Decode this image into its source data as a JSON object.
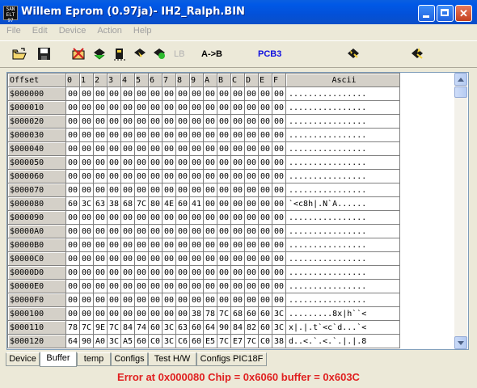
{
  "window": {
    "title": "Willem Eprom (0.97ja)- IH2_Ralph.BIN",
    "icon_text": "SAN\nELT\n97"
  },
  "menu": [
    "File",
    "Edit",
    "Device",
    "Action",
    "Help"
  ],
  "toolbar": {
    "lb_label": "LB",
    "ab_label": "A->B",
    "pcb_label": "PCB3",
    "pcb_color": "#1010E0"
  },
  "grid": {
    "header": [
      "Offset",
      "0",
      "1",
      "2",
      "3",
      "4",
      "5",
      "6",
      "7",
      "8",
      "9",
      "A",
      "B",
      "C",
      "D",
      "E",
      "F",
      "Ascii"
    ],
    "rows": [
      {
        "offset": "$000000",
        "bytes": [
          "00",
          "00",
          "00",
          "00",
          "00",
          "00",
          "00",
          "00",
          "00",
          "00",
          "00",
          "00",
          "00",
          "00",
          "00",
          "00"
        ],
        "ascii": "................"
      },
      {
        "offset": "$000010",
        "bytes": [
          "00",
          "00",
          "00",
          "00",
          "00",
          "00",
          "00",
          "00",
          "00",
          "00",
          "00",
          "00",
          "00",
          "00",
          "00",
          "00"
        ],
        "ascii": "................"
      },
      {
        "offset": "$000020",
        "bytes": [
          "00",
          "00",
          "00",
          "00",
          "00",
          "00",
          "00",
          "00",
          "00",
          "00",
          "00",
          "00",
          "00",
          "00",
          "00",
          "00"
        ],
        "ascii": "................"
      },
      {
        "offset": "$000030",
        "bytes": [
          "00",
          "00",
          "00",
          "00",
          "00",
          "00",
          "00",
          "00",
          "00",
          "00",
          "00",
          "00",
          "00",
          "00",
          "00",
          "00"
        ],
        "ascii": "................"
      },
      {
        "offset": "$000040",
        "bytes": [
          "00",
          "00",
          "00",
          "00",
          "00",
          "00",
          "00",
          "00",
          "00",
          "00",
          "00",
          "00",
          "00",
          "00",
          "00",
          "00"
        ],
        "ascii": "................"
      },
      {
        "offset": "$000050",
        "bytes": [
          "00",
          "00",
          "00",
          "00",
          "00",
          "00",
          "00",
          "00",
          "00",
          "00",
          "00",
          "00",
          "00",
          "00",
          "00",
          "00"
        ],
        "ascii": "................"
      },
      {
        "offset": "$000060",
        "bytes": [
          "00",
          "00",
          "00",
          "00",
          "00",
          "00",
          "00",
          "00",
          "00",
          "00",
          "00",
          "00",
          "00",
          "00",
          "00",
          "00"
        ],
        "ascii": "................"
      },
      {
        "offset": "$000070",
        "bytes": [
          "00",
          "00",
          "00",
          "00",
          "00",
          "00",
          "00",
          "00",
          "00",
          "00",
          "00",
          "00",
          "00",
          "00",
          "00",
          "00"
        ],
        "ascii": "................"
      },
      {
        "offset": "$000080",
        "bytes": [
          "60",
          "3C",
          "63",
          "38",
          "68",
          "7C",
          "80",
          "4E",
          "60",
          "41",
          "00",
          "00",
          "00",
          "00",
          "00",
          "00"
        ],
        "ascii": "`<c8h|.N`A......"
      },
      {
        "offset": "$000090",
        "bytes": [
          "00",
          "00",
          "00",
          "00",
          "00",
          "00",
          "00",
          "00",
          "00",
          "00",
          "00",
          "00",
          "00",
          "00",
          "00",
          "00"
        ],
        "ascii": "................"
      },
      {
        "offset": "$0000A0",
        "bytes": [
          "00",
          "00",
          "00",
          "00",
          "00",
          "00",
          "00",
          "00",
          "00",
          "00",
          "00",
          "00",
          "00",
          "00",
          "00",
          "00"
        ],
        "ascii": "................"
      },
      {
        "offset": "$0000B0",
        "bytes": [
          "00",
          "00",
          "00",
          "00",
          "00",
          "00",
          "00",
          "00",
          "00",
          "00",
          "00",
          "00",
          "00",
          "00",
          "00",
          "00"
        ],
        "ascii": "................"
      },
      {
        "offset": "$0000C0",
        "bytes": [
          "00",
          "00",
          "00",
          "00",
          "00",
          "00",
          "00",
          "00",
          "00",
          "00",
          "00",
          "00",
          "00",
          "00",
          "00",
          "00"
        ],
        "ascii": "................"
      },
      {
        "offset": "$0000D0",
        "bytes": [
          "00",
          "00",
          "00",
          "00",
          "00",
          "00",
          "00",
          "00",
          "00",
          "00",
          "00",
          "00",
          "00",
          "00",
          "00",
          "00"
        ],
        "ascii": "................"
      },
      {
        "offset": "$0000E0",
        "bytes": [
          "00",
          "00",
          "00",
          "00",
          "00",
          "00",
          "00",
          "00",
          "00",
          "00",
          "00",
          "00",
          "00",
          "00",
          "00",
          "00"
        ],
        "ascii": "................"
      },
      {
        "offset": "$0000F0",
        "bytes": [
          "00",
          "00",
          "00",
          "00",
          "00",
          "00",
          "00",
          "00",
          "00",
          "00",
          "00",
          "00",
          "00",
          "00",
          "00",
          "00"
        ],
        "ascii": "................"
      },
      {
        "offset": "$000100",
        "bytes": [
          "00",
          "00",
          "00",
          "00",
          "00",
          "00",
          "00",
          "00",
          "00",
          "38",
          "78",
          "7C",
          "68",
          "60",
          "60",
          "3C"
        ],
        "ascii": ".........8x|h``<"
      },
      {
        "offset": "$000110",
        "bytes": [
          "78",
          "7C",
          "9E",
          "7C",
          "84",
          "74",
          "60",
          "3C",
          "63",
          "60",
          "64",
          "90",
          "84",
          "82",
          "60",
          "3C"
        ],
        "ascii": "x|.|.t`<c`d...`<"
      },
      {
        "offset": "$000120",
        "bytes": [
          "64",
          "90",
          "A0",
          "3C",
          "A5",
          "60",
          "C0",
          "3C",
          "C6",
          "60",
          "E5",
          "7C",
          "E7",
          "7C",
          "C0",
          "38"
        ],
        "ascii": "d..<.`.<.`.|.|.8"
      }
    ]
  },
  "tabs": [
    {
      "label": "Device",
      "active": false
    },
    {
      "label": "Buffer",
      "active": true
    },
    {
      "label": "temp",
      "active": false
    },
    {
      "label": "Configs",
      "active": false
    },
    {
      "label": "Test H/W",
      "active": false
    },
    {
      "label": "Configs PIC18F",
      "active": false
    }
  ],
  "status": {
    "text": "Error at 0x000080  Chip = 0x6060  buffer = 0x603C",
    "color": "#E02020"
  }
}
